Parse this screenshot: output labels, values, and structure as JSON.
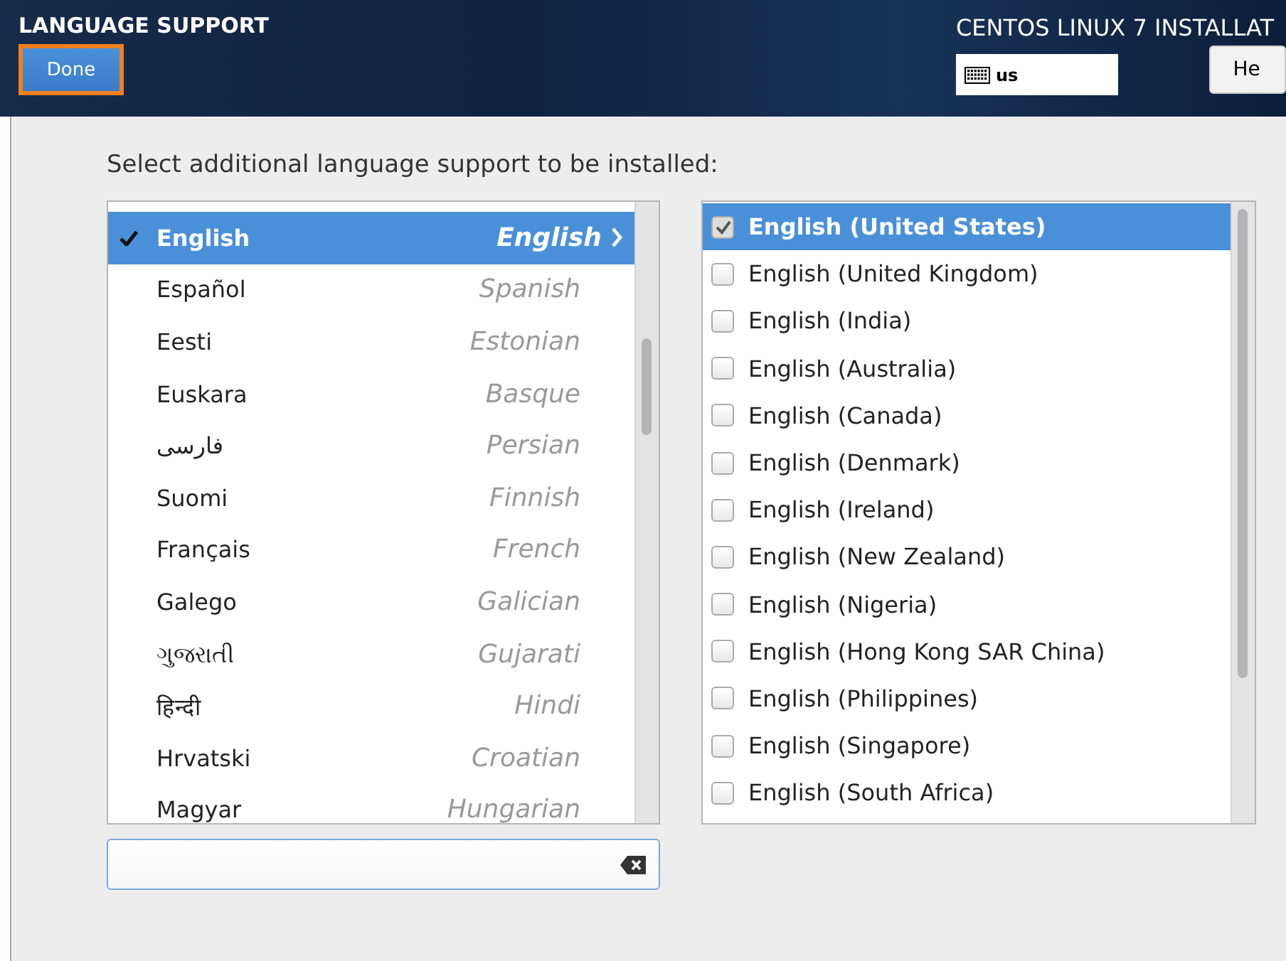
{
  "header": {
    "title": "LANGUAGE SUPPORT",
    "done_button": "Done",
    "product_title": "CENTOS LINUX 7 INSTALLAT",
    "keyboard_layout": "us",
    "help_button": "He"
  },
  "prompt": "Select additional language support to be installed:",
  "languages": [
    {
      "native": "English",
      "english": "English",
      "selected": true
    },
    {
      "native": "Español",
      "english": "Spanish",
      "selected": false
    },
    {
      "native": "Eesti",
      "english": "Estonian",
      "selected": false
    },
    {
      "native": "Euskara",
      "english": "Basque",
      "selected": false
    },
    {
      "native": "فارسی",
      "english": "Persian",
      "selected": false
    },
    {
      "native": "Suomi",
      "english": "Finnish",
      "selected": false
    },
    {
      "native": "Français",
      "english": "French",
      "selected": false
    },
    {
      "native": "Galego",
      "english": "Galician",
      "selected": false
    },
    {
      "native": "ગુજરાતી",
      "english": "Gujarati",
      "selected": false
    },
    {
      "native": "हिन्दी",
      "english": "Hindi",
      "selected": false
    },
    {
      "native": "Hrvatski",
      "english": "Croatian",
      "selected": false
    },
    {
      "native": "Magyar",
      "english": "Hungarian",
      "selected": false
    }
  ],
  "locales": [
    {
      "label": "English (United States)",
      "checked": true,
      "selected": true
    },
    {
      "label": "English (United Kingdom)",
      "checked": false,
      "selected": false
    },
    {
      "label": "English (India)",
      "checked": false,
      "selected": false
    },
    {
      "label": "English (Australia)",
      "checked": false,
      "selected": false
    },
    {
      "label": "English (Canada)",
      "checked": false,
      "selected": false
    },
    {
      "label": "English (Denmark)",
      "checked": false,
      "selected": false
    },
    {
      "label": "English (Ireland)",
      "checked": false,
      "selected": false
    },
    {
      "label": "English (New Zealand)",
      "checked": false,
      "selected": false
    },
    {
      "label": "English (Nigeria)",
      "checked": false,
      "selected": false
    },
    {
      "label": "English (Hong Kong SAR China)",
      "checked": false,
      "selected": false
    },
    {
      "label": "English (Philippines)",
      "checked": false,
      "selected": false
    },
    {
      "label": "English (Singapore)",
      "checked": false,
      "selected": false
    },
    {
      "label": "English (South Africa)",
      "checked": false,
      "selected": false
    }
  ]
}
